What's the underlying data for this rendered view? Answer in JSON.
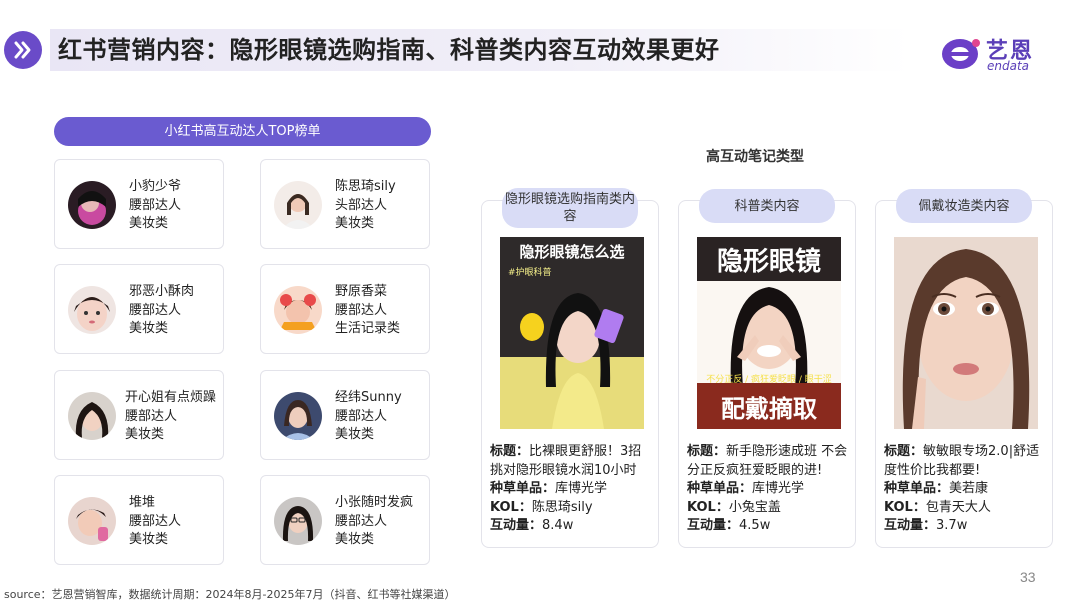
{
  "header": {
    "title": "红书营销内容：隐形眼镜选购指南、科普类内容互动效果更好",
    "logo_cn": "艺恩",
    "logo_en": "endata"
  },
  "left_panel": {
    "title": "小红书高互动达人TOP榜单",
    "kols": [
      {
        "name": "小豹少爷",
        "tier": "腰部达人",
        "category": "美妆类"
      },
      {
        "name": "陈思琦sily",
        "tier": "头部达人",
        "category": "美妆类"
      },
      {
        "name": "邪恶小酥肉",
        "tier": "腰部达人",
        "category": "美妆类"
      },
      {
        "name": "野原香菜",
        "tier": "腰部达人",
        "category": "生活记录类"
      },
      {
        "name": "开心姐有点烦躁",
        "tier": "腰部达人",
        "category": "美妆类"
      },
      {
        "name": "经纬Sunny",
        "tier": "腰部达人",
        "category": "美妆类"
      },
      {
        "name": "堆堆",
        "tier": "腰部达人",
        "category": "美妆类"
      },
      {
        "name": "小张随时发疯",
        "tier": "腰部达人",
        "category": "美妆类"
      }
    ]
  },
  "right_panel": {
    "title": "高互动笔记类型",
    "cards": [
      {
        "tag": "隐形眼镜选购指南类内容",
        "cover_text": "隐形眼镜怎么选",
        "cover_sub": "#护眼科普",
        "title_label": "标题：",
        "title": "比裸眼更舒服！3招挑对隐形眼镜水润10小时",
        "product_label": "种草单品：",
        "product": "库博光学",
        "kol_label": "KOL：",
        "kol": "陈思琦sily",
        "interact_label": "互动量：",
        "interact": "8.4w"
      },
      {
        "tag": "科普类内容",
        "cover_text": "隐形眼镜",
        "cover_sub": "不分正反 / 疯狂爱眨眼 / 眼干涩",
        "cover_bottom": "配戴摘取",
        "title_label": "标题：",
        "title": "新手隐形速成班 不会分正反疯狂爱眨眼的进!",
        "product_label": "种草单品：",
        "product": "库博光学",
        "kol_label": "KOL：",
        "kol": "小兔宝盖",
        "interact_label": "互动量：",
        "interact": "4.5w"
      },
      {
        "tag": "佩戴妆造类内容",
        "title_label": "标题：",
        "title": "敏敏眼专场2.0|舒适度性价比我都要!",
        "product_label": "种草单品：",
        "product": "美若康",
        "kol_label": "KOL：",
        "kol": "包青天大人",
        "interact_label": "互动量：",
        "interact": "3.7w"
      }
    ]
  },
  "footer": {
    "source": "source：艺恩营销智库，数据统计周期：2024年8月-2025年7月（抖音、红书等社媒渠道）",
    "page_number": "33"
  },
  "colors": {
    "accent": "#6a5bd0",
    "tag_bg": "#d9dcf6",
    "brand": "#5b3fb8"
  }
}
